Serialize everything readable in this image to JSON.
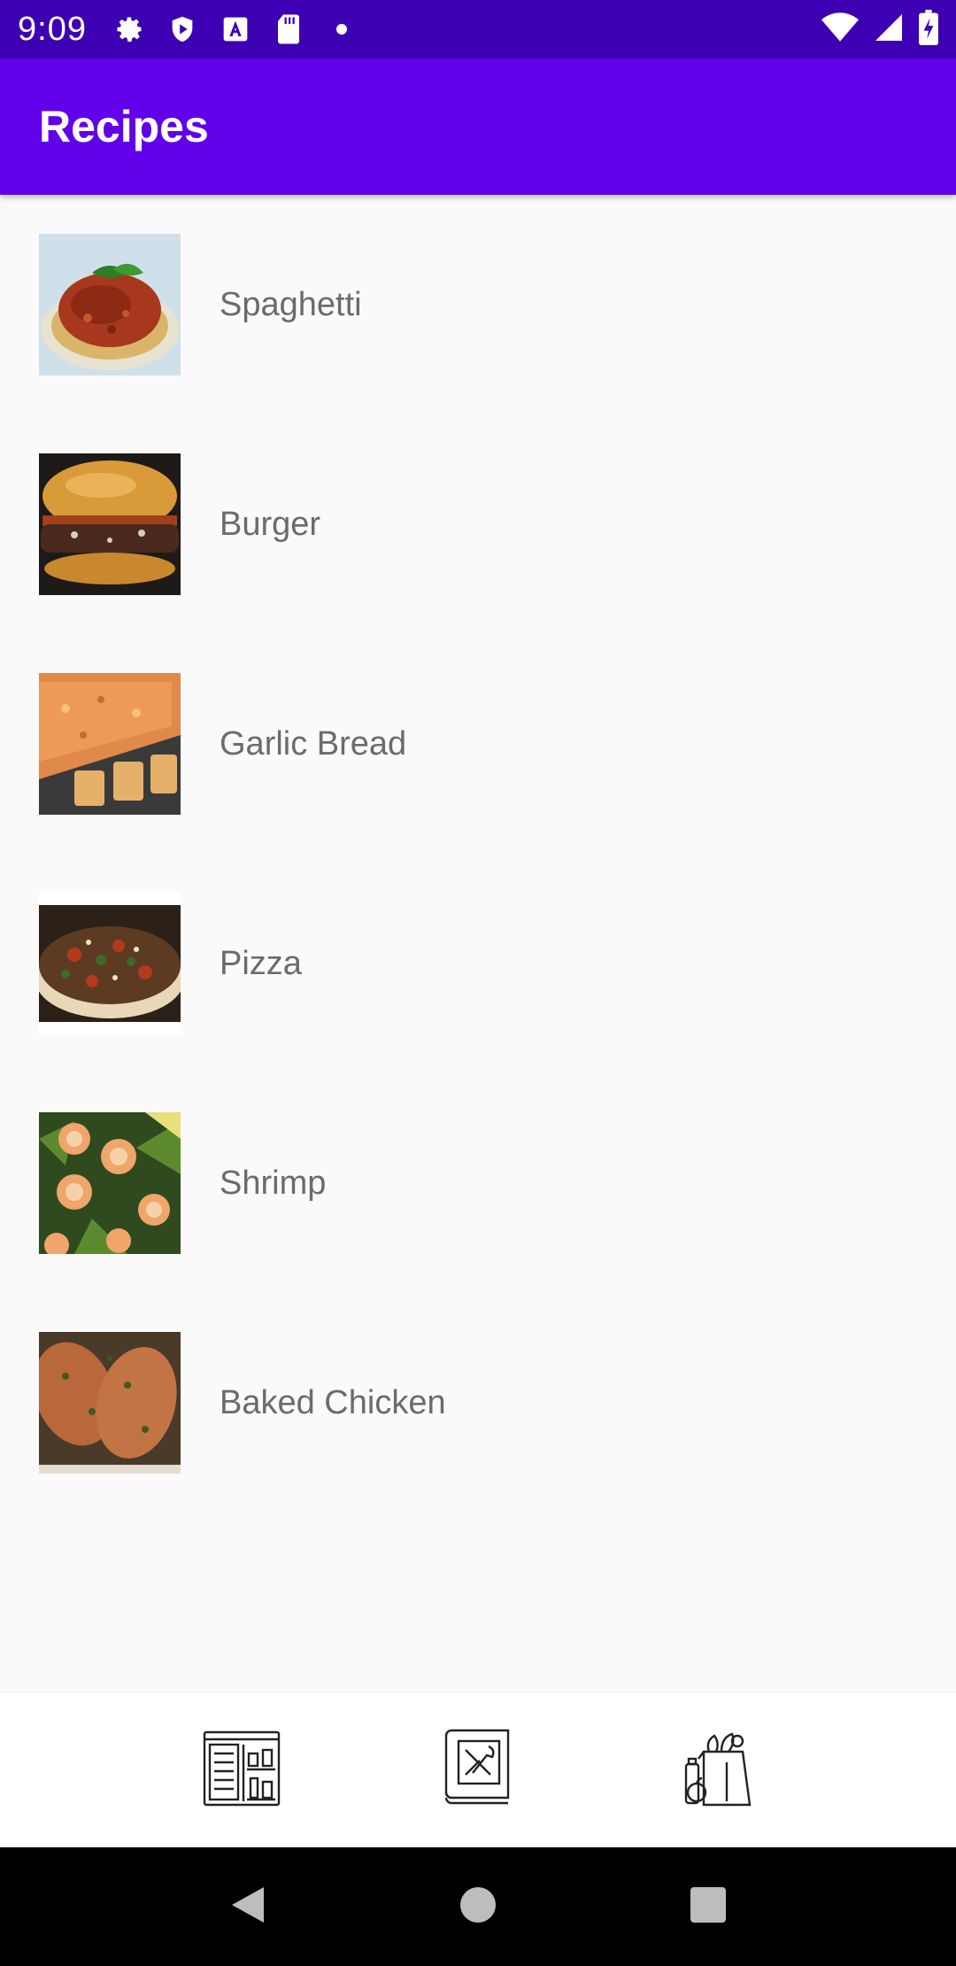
{
  "status_bar": {
    "time": "9:09",
    "icons": [
      "settings-icon",
      "shield-icon",
      "font-icon",
      "sd-card-icon",
      "dot-icon",
      "wifi-icon",
      "signal-icon",
      "battery-icon"
    ]
  },
  "app_bar": {
    "title": "Recipes"
  },
  "recipes": [
    {
      "name": "Spaghetti",
      "image": "spaghetti-image"
    },
    {
      "name": "Burger",
      "image": "burger-image"
    },
    {
      "name": "Garlic Bread",
      "image": "garlic-bread-image"
    },
    {
      "name": "Pizza",
      "image": "pizza-image"
    },
    {
      "name": "Shrimp",
      "image": "shrimp-image"
    },
    {
      "name": "Baked Chicken",
      "image": "baked-chicken-image"
    }
  ],
  "bottom_nav": {
    "items": [
      "menu-board-icon",
      "recipe-book-icon",
      "grocery-bag-icon"
    ]
  },
  "colors": {
    "status_bar": "#3d00b3",
    "app_bar": "#6200ea",
    "background": "#fafafa",
    "label_text": "#6b6b6b"
  }
}
